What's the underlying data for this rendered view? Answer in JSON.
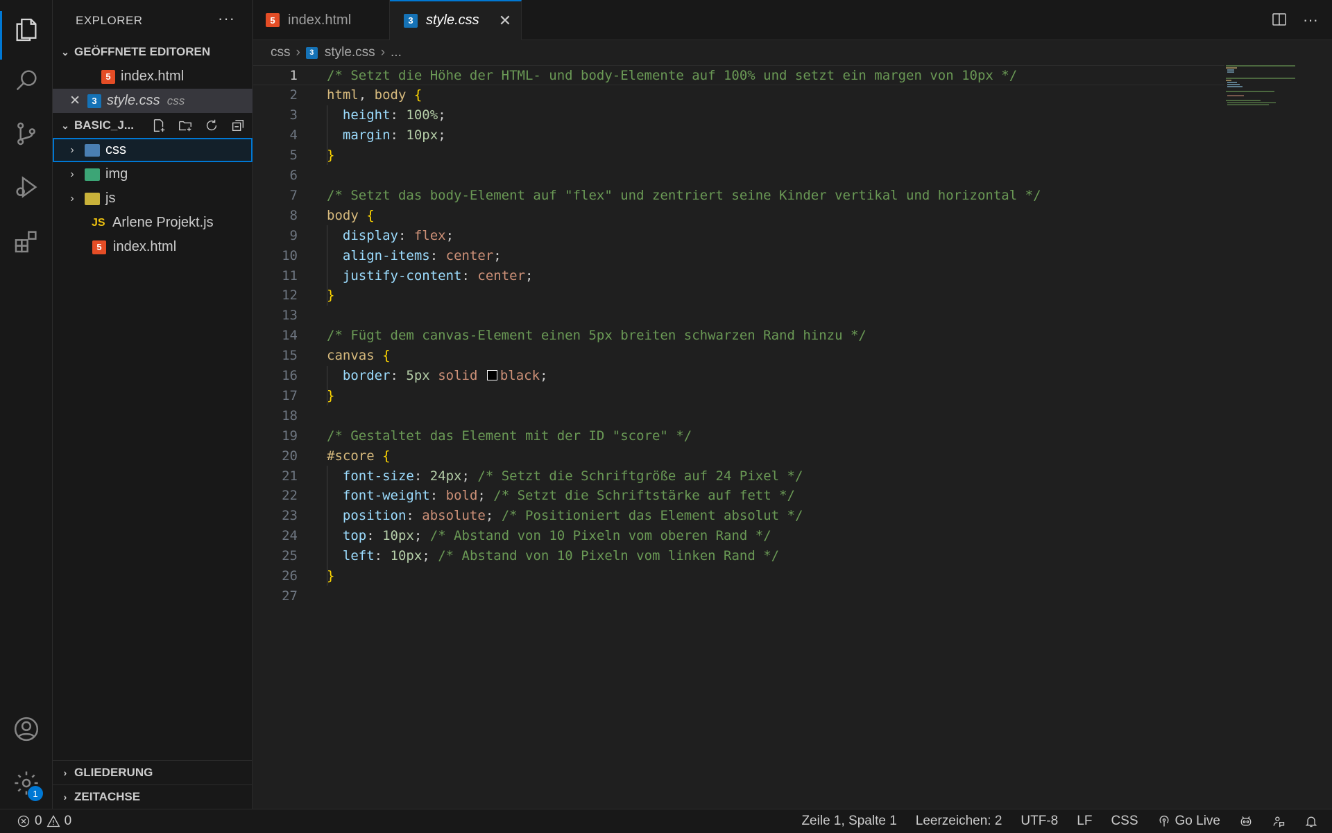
{
  "colors": {
    "accent": "#0078d4",
    "html_icon": "#e44d26",
    "css_icon": "#1572b6",
    "js_icon": "#f1c40f"
  },
  "activity_bar": {
    "settings_badge": "1"
  },
  "sidebar": {
    "title": "EXPLORER",
    "more": "···",
    "open_editors": {
      "heading": "GEÖFFNETE EDITOREN",
      "items": [
        {
          "name": "index.html",
          "desc": ""
        },
        {
          "name": "style.css",
          "desc": "css"
        }
      ]
    },
    "workspace": {
      "heading": "BASIC_J...",
      "items": [
        {
          "name": "css",
          "kind": "folder"
        },
        {
          "name": "img",
          "kind": "folder"
        },
        {
          "name": "js",
          "kind": "folder"
        },
        {
          "name": "Arlene Projekt.js",
          "kind": "js-file",
          "icon_label": "JS"
        },
        {
          "name": "index.html",
          "kind": "html-file"
        }
      ]
    },
    "outline": "GLIEDERUNG",
    "timeline": "ZEITACHSE"
  },
  "tabs": [
    {
      "label": "index.html",
      "active": false
    },
    {
      "label": "style.css",
      "active": true,
      "close": "✕"
    }
  ],
  "editor_actions": {
    "more": "···"
  },
  "breadcrumb": {
    "folder": "css",
    "file": "style.css",
    "ellipsis": "..."
  },
  "editor": {
    "lines": [
      {
        "n": "1",
        "tokens": [
          [
            "com",
            "/* Setzt die Höhe der HTML- und body-Elemente auf 100% und setzt ein margen von 10px */"
          ]
        ]
      },
      {
        "n": "2",
        "tokens": [
          [
            "sel",
            "html"
          ],
          [
            "plain",
            ", "
          ],
          [
            "sel",
            "body"
          ],
          [
            "plain",
            " "
          ],
          [
            "brace",
            "{"
          ]
        ]
      },
      {
        "n": "3",
        "tokens": [
          [
            "plain",
            "  "
          ],
          [
            "prop",
            "height"
          ],
          [
            "plain",
            ": "
          ],
          [
            "num",
            "100%"
          ],
          [
            "plain",
            ";"
          ]
        ]
      },
      {
        "n": "4",
        "tokens": [
          [
            "plain",
            "  "
          ],
          [
            "prop",
            "margin"
          ],
          [
            "plain",
            ": "
          ],
          [
            "num",
            "10px"
          ],
          [
            "plain",
            ";"
          ]
        ]
      },
      {
        "n": "5",
        "tokens": [
          [
            "brace",
            "}"
          ]
        ]
      },
      {
        "n": "6",
        "tokens": []
      },
      {
        "n": "7",
        "tokens": [
          [
            "com",
            "/* Setzt das body-Element auf \"flex\" und zentriert seine Kinder vertikal und horizontal */"
          ]
        ]
      },
      {
        "n": "8",
        "tokens": [
          [
            "sel",
            "body"
          ],
          [
            "plain",
            " "
          ],
          [
            "brace",
            "{"
          ]
        ]
      },
      {
        "n": "9",
        "tokens": [
          [
            "plain",
            "  "
          ],
          [
            "prop",
            "display"
          ],
          [
            "plain",
            ": "
          ],
          [
            "val",
            "flex"
          ],
          [
            "plain",
            ";"
          ]
        ]
      },
      {
        "n": "10",
        "tokens": [
          [
            "plain",
            "  "
          ],
          [
            "prop",
            "align-items"
          ],
          [
            "plain",
            ": "
          ],
          [
            "val",
            "center"
          ],
          [
            "plain",
            ";"
          ]
        ]
      },
      {
        "n": "11",
        "tokens": [
          [
            "plain",
            "  "
          ],
          [
            "prop",
            "justify-content"
          ],
          [
            "plain",
            ": "
          ],
          [
            "val",
            "center"
          ],
          [
            "plain",
            ";"
          ]
        ]
      },
      {
        "n": "12",
        "tokens": [
          [
            "brace",
            "}"
          ]
        ]
      },
      {
        "n": "13",
        "tokens": []
      },
      {
        "n": "14",
        "tokens": [
          [
            "com",
            "/* Fügt dem canvas-Element einen 5px breiten schwarzen Rand hinzu */"
          ]
        ]
      },
      {
        "n": "15",
        "tokens": [
          [
            "sel",
            "canvas"
          ],
          [
            "plain",
            " "
          ],
          [
            "brace",
            "{"
          ]
        ]
      },
      {
        "n": "16",
        "tokens": [
          [
            "plain",
            "  "
          ],
          [
            "prop",
            "border"
          ],
          [
            "plain",
            ": "
          ],
          [
            "num",
            "5px"
          ],
          [
            "plain",
            " "
          ],
          [
            "val",
            "solid"
          ],
          [
            "plain",
            " "
          ],
          [
            "swatch",
            ""
          ],
          [
            "val",
            "black"
          ],
          [
            "plain",
            ";"
          ]
        ]
      },
      {
        "n": "17",
        "tokens": [
          [
            "brace",
            "}"
          ]
        ]
      },
      {
        "n": "18",
        "tokens": []
      },
      {
        "n": "19",
        "tokens": [
          [
            "com",
            "/* Gestaltet das Element mit der ID \"score\" */"
          ]
        ]
      },
      {
        "n": "20",
        "tokens": [
          [
            "sel",
            "#score"
          ],
          [
            "plain",
            " "
          ],
          [
            "brace",
            "{"
          ]
        ]
      },
      {
        "n": "21",
        "tokens": [
          [
            "plain",
            "  "
          ],
          [
            "prop",
            "font-size"
          ],
          [
            "plain",
            ": "
          ],
          [
            "num",
            "24px"
          ],
          [
            "plain",
            "; "
          ],
          [
            "com",
            "/* Setzt die Schriftgröße auf 24 Pixel */"
          ]
        ]
      },
      {
        "n": "22",
        "tokens": [
          [
            "plain",
            "  "
          ],
          [
            "prop",
            "font-weight"
          ],
          [
            "plain",
            ": "
          ],
          [
            "val",
            "bold"
          ],
          [
            "plain",
            "; "
          ],
          [
            "com",
            "/* Setzt die Schriftstärke auf fett */"
          ]
        ]
      },
      {
        "n": "23",
        "tokens": [
          [
            "plain",
            "  "
          ],
          [
            "prop",
            "position"
          ],
          [
            "plain",
            ": "
          ],
          [
            "val",
            "absolute"
          ],
          [
            "plain",
            "; "
          ],
          [
            "com",
            "/* Positioniert das Element absolut */"
          ]
        ]
      },
      {
        "n": "24",
        "tokens": [
          [
            "plain",
            "  "
          ],
          [
            "prop",
            "top"
          ],
          [
            "plain",
            ": "
          ],
          [
            "num",
            "10px"
          ],
          [
            "plain",
            "; "
          ],
          [
            "com",
            "/* Abstand von 10 Pixeln vom oberen Rand */"
          ]
        ]
      },
      {
        "n": "25",
        "tokens": [
          [
            "plain",
            "  "
          ],
          [
            "prop",
            "left"
          ],
          [
            "plain",
            ": "
          ],
          [
            "num",
            "10px"
          ],
          [
            "plain",
            "; "
          ],
          [
            "com",
            "/* Abstand von 10 Pixeln vom linken Rand */"
          ]
        ]
      },
      {
        "n": "26",
        "tokens": [
          [
            "brace",
            "}"
          ]
        ]
      },
      {
        "n": "27",
        "tokens": []
      }
    ]
  },
  "status_bar": {
    "errors": "0",
    "warnings": "0",
    "position": "Zeile 1, Spalte 1",
    "indent": "Leerzeichen: 2",
    "encoding": "UTF-8",
    "eol": "LF",
    "language": "CSS",
    "go_live": "Go Live"
  }
}
